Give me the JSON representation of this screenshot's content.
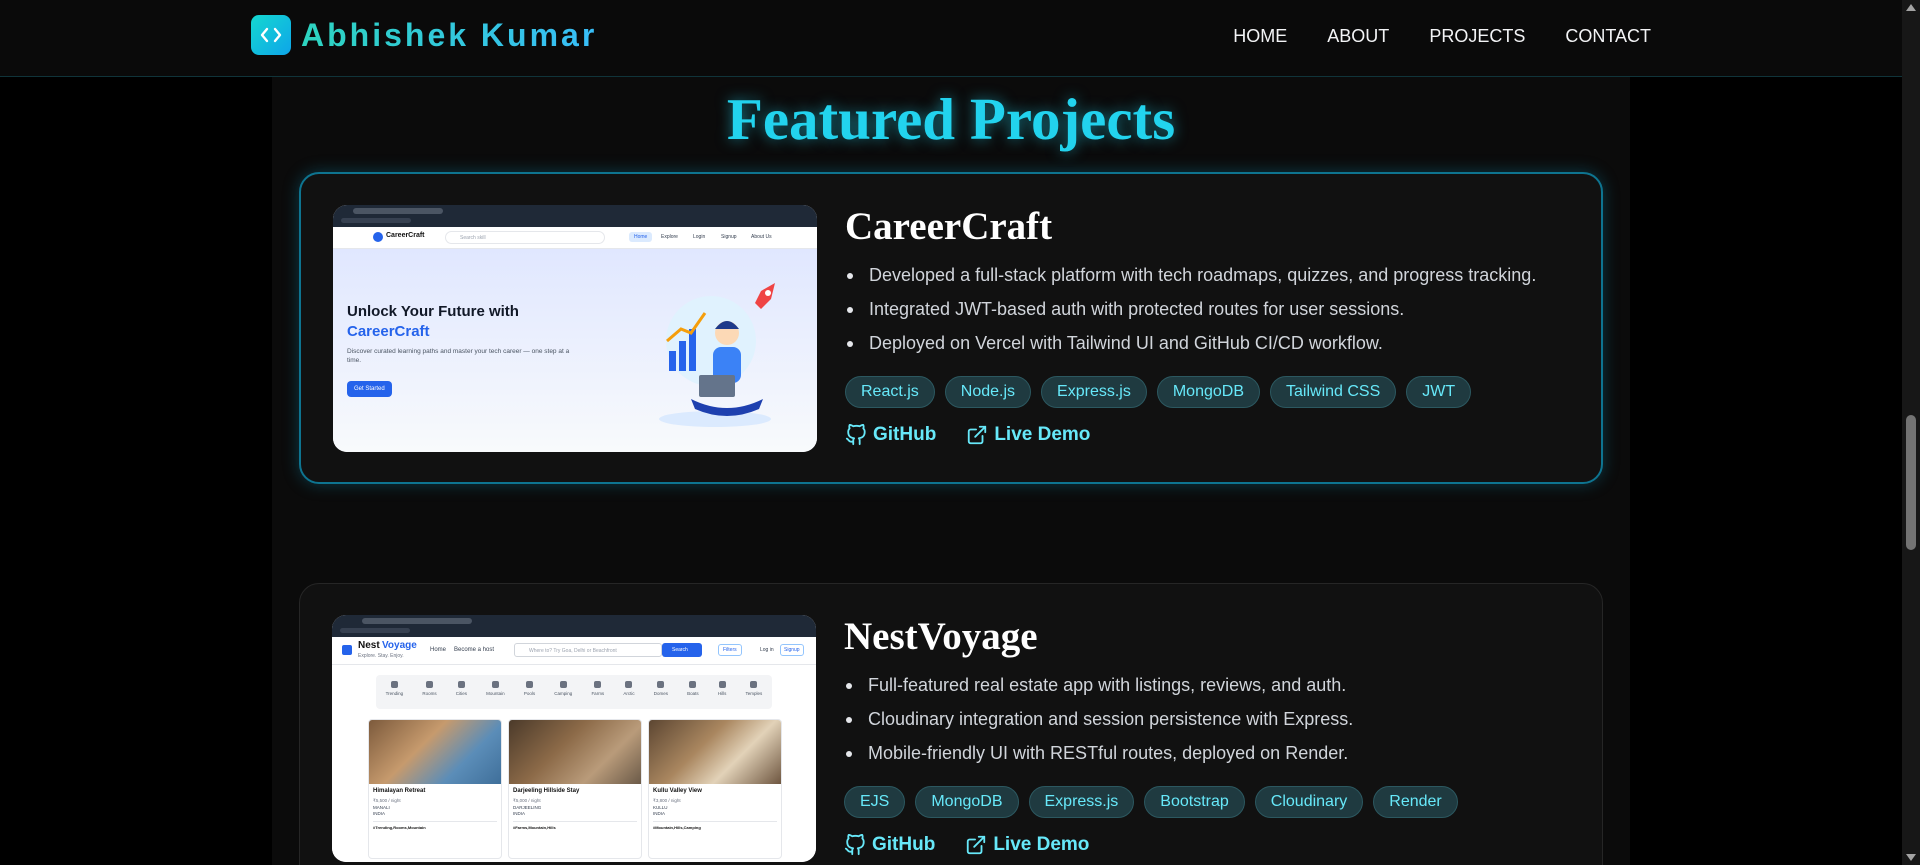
{
  "brand": {
    "name": "Abhishek Kumar",
    "logo_icon": "code-brackets-icon"
  },
  "nav": {
    "items": [
      "HOME",
      "ABOUT",
      "PROJECTS",
      "CONTACT"
    ]
  },
  "section": {
    "title": "Featured Projects"
  },
  "projects": [
    {
      "title": "CareerCraft",
      "bullets": [
        "Developed a full-stack platform with tech roadmaps, quizzes, and progress tracking.",
        "Integrated JWT-based auth with protected routes for user sessions.",
        "Deployed on Vercel with Tailwind UI and GitHub CI/CD workflow."
      ],
      "tags": [
        "React.js",
        "Node.js",
        "Express.js",
        "MongoDB",
        "Tailwind CSS",
        "JWT"
      ],
      "github_label": "GitHub",
      "demo_label": "Live Demo",
      "screenshot": {
        "brand": "CareerCraft",
        "search_placeholder": "Search skill",
        "menu": [
          "Home",
          "Explore",
          "Login",
          "Signup",
          "About Us"
        ],
        "headline_1": "Unlock Your Future with",
        "headline_2": "CareerCraft",
        "subtext": "Discover curated learning paths and master your tech career — one step at a time.",
        "cta": "Get Started"
      }
    },
    {
      "title": "NestVoyage",
      "bullets": [
        "Full-featured real estate app with listings, reviews, and auth.",
        "Cloudinary integration and session persistence with Express.",
        "Mobile-friendly UI with RESTful routes, deployed on Render."
      ],
      "tags": [
        "EJS",
        "MongoDB",
        "Express.js",
        "Bootstrap",
        "Cloudinary",
        "Render"
      ],
      "github_label": "GitHub",
      "demo_label": "Live Demo",
      "screenshot": {
        "brand_a": "Nest",
        "brand_b": "Voyage",
        "tagline": "Explore. Stay. Enjoy.",
        "menu": [
          "Home",
          "Become a host"
        ],
        "search_placeholder": "Where to? Try Goa, Delhi or Beachfront",
        "search_button": "Search",
        "filters_label": "Filters",
        "login": "Log in",
        "signup": "Signup",
        "categories": [
          "Trending",
          "Rooms",
          "Cities",
          "Mountain",
          "Pools",
          "Camping",
          "Farms",
          "Arctic",
          "Domes",
          "Boats",
          "Hills",
          "Temples"
        ],
        "listings": [
          {
            "name": "Himalayan Retreat",
            "price": "₹5,500 / night",
            "place": "MANALI",
            "country": "INDIA",
            "tags": "#Trending,Rooms,Mountain"
          },
          {
            "name": "Darjeeling Hillside Stay",
            "price": "₹5,000 / night",
            "place": "DARJEELING",
            "country": "INDIA",
            "tags": "#Farms,Mountain,Hills"
          },
          {
            "name": "Kullu Valley View",
            "price": "₹3,800 / night",
            "place": "KULLU",
            "country": "INDIA",
            "tags": "#Mountain,Hills,Camping"
          }
        ]
      }
    }
  ]
}
